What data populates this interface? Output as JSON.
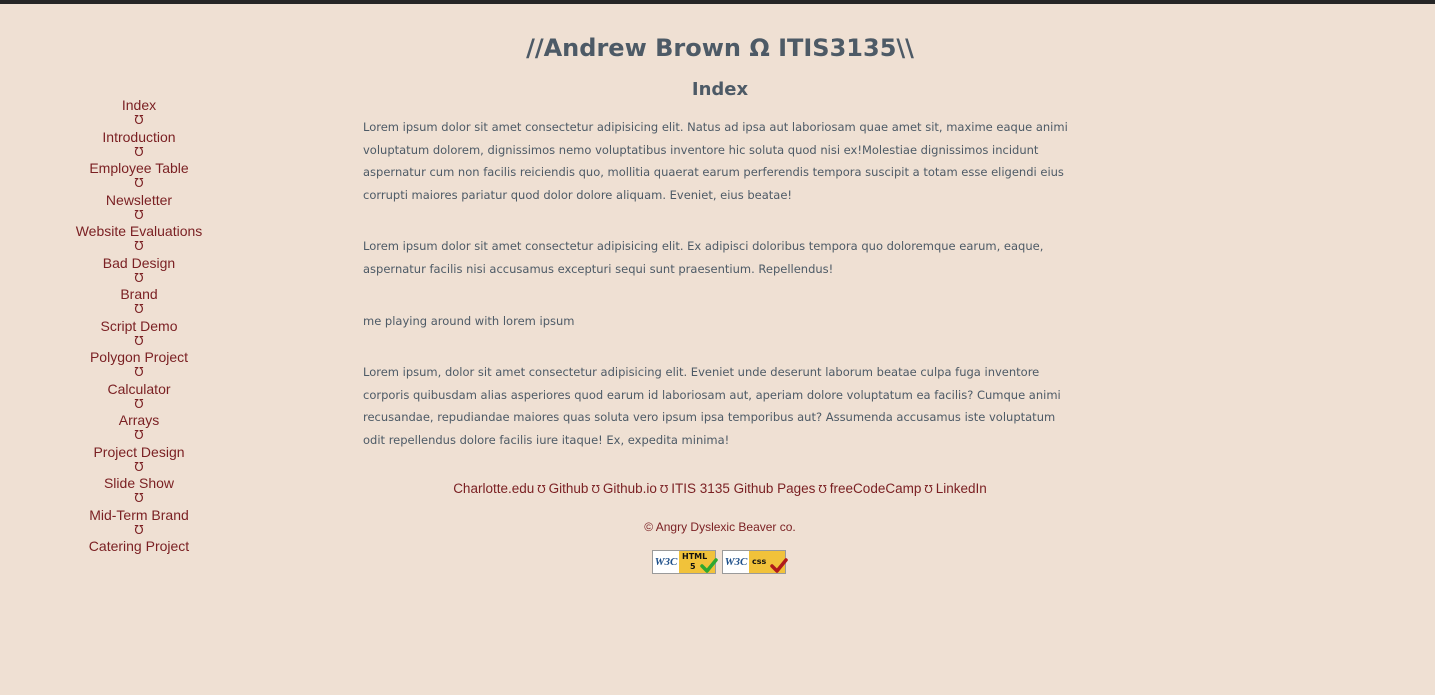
{
  "header": {
    "site_title": "//Andrew Brown Ω ITIS3135\\\\",
    "page_title": "Index"
  },
  "sidebar": {
    "separator": "Ʊ",
    "items": [
      {
        "label": "Index"
      },
      {
        "label": "Introduction"
      },
      {
        "label": "Employee Table"
      },
      {
        "label": "Newsletter"
      },
      {
        "label": "Website Evaluations"
      },
      {
        "label": "Bad Design"
      },
      {
        "label": "Brand"
      },
      {
        "label": "Script Demo"
      },
      {
        "label": "Polygon Project"
      },
      {
        "label": "Calculator"
      },
      {
        "label": "Arrays"
      },
      {
        "label": "Project Design"
      },
      {
        "label": "Slide Show"
      },
      {
        "label": "Mid-Term Brand"
      },
      {
        "label": "Catering Project"
      }
    ]
  },
  "main": {
    "paragraphs": [
      "Lorem ipsum dolor sit amet consectetur adipisicing elit. Natus ad ipsa aut laboriosam quae amet sit, maxime eaque animi voluptatum dolorem, dignissimos nemo voluptatibus inventore hic soluta quod nisi ex!Molestiae dignissimos incidunt aspernatur cum non facilis reiciendis quo, mollitia quaerat earum perferendis tempora suscipit a totam esse eligendi eius corrupti maiores pariatur quod dolor dolore aliquam. Eveniet, eius beatae!",
      "Lorem ipsum dolor sit amet consectetur adipisicing elit. Ex adipisci doloribus tempora quo doloremque earum, eaque, aspernatur facilis nisi accusamus excepturi sequi sunt praesentium. Repellendus!",
      "me playing around with lorem ipsum",
      "Lorem ipsum, dolor sit amet consectetur adipisicing elit. Eveniet unde deserunt laborum beatae culpa fuga inventore corporis quibusdam alias asperiores quod earum id laboriosam aut, aperiam dolore voluptatum ea facilis? Cumque animi recusandae, repudiandae maiores quas soluta vero ipsum ipsa temporibus aut? Assumenda accusamus iste voluptatum odit repellendus dolore facilis iure itaque! Ex, expedita minima!"
    ]
  },
  "footer": {
    "separator": "Ʊ",
    "links": [
      {
        "label": "Charlotte.edu"
      },
      {
        "label": "Github"
      },
      {
        "label": "Github.io"
      },
      {
        "label": "ITIS 3135 Github Pages"
      },
      {
        "label": "freeCodeCamp"
      },
      {
        "label": "LinkedIn"
      }
    ],
    "copyright": "© Angry Dyslexic Beaver co.",
    "badges": [
      {
        "left_text": "W3C",
        "line1": "HTML",
        "line2": "5",
        "icon": "check-icon"
      },
      {
        "left_text": "W3C",
        "line1": "css",
        "line2": "",
        "icon": "check-icon"
      }
    ]
  },
  "colors": {
    "background": "#efe0d3",
    "top_bar": "#262626",
    "heading_text": "#4d5a66",
    "link": "#7a1f22",
    "badge_yellow": "#f1c23a",
    "html_check": "#2fa82f",
    "css_check": "#b01b1b"
  }
}
